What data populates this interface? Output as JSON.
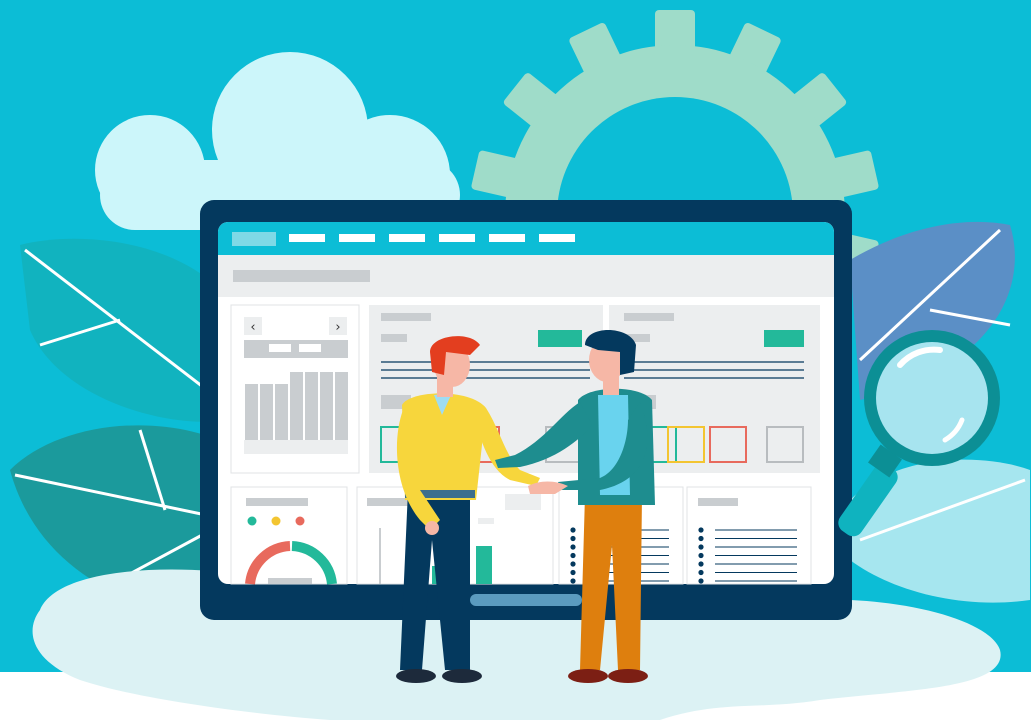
{
  "illustration": {
    "subject": "business-handshake-dashboard",
    "colors": {
      "sky": "#0cbdd6",
      "ground": "#ffffff",
      "cloud": "#ccf6fa",
      "gear": "#9fdcc9",
      "monitor_frame": "#04395e",
      "screen_bg": "#ffffff",
      "nav_bar": "#0cbdd6",
      "panel_bg": "#eceeef",
      "accent_green": "#23b99a",
      "accent_yellow": "#f3c531",
      "accent_red": "#e86a5d",
      "placeholder_gray": "#c9cdd0",
      "magnifier_ring": "#0c8f95",
      "leaf_teal": "#1b9a9c",
      "leaf_blue": "#5b8fc6"
    },
    "icons": [
      "cloud-icon",
      "gear-icon",
      "magnifier-icon",
      "chevron-left-icon",
      "chevron-right-icon",
      "donut-chart-icon",
      "bar-chart-icon"
    ],
    "dashboard": {
      "nav_tab_count": 6,
      "legend_dot_colors": [
        "#23b99a",
        "#f3c531",
        "#e86a5d"
      ],
      "tile_colors": [
        "#23b99a",
        "#e86a5d",
        "#b8bcbf",
        "#23b99a",
        "#f3c531",
        "#e86a5d",
        "#b8bcbf"
      ]
    }
  }
}
